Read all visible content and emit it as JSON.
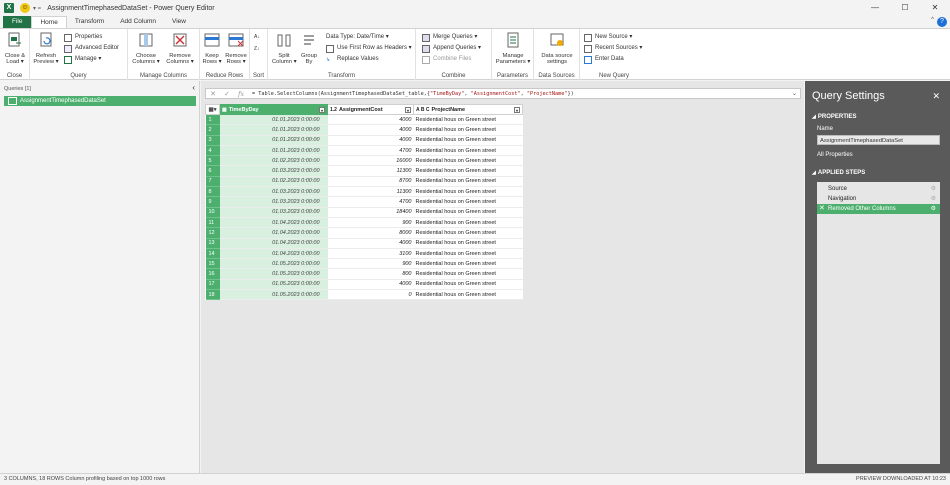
{
  "window": {
    "title": "AssignmentTimephasedDataSet - Power Query Editor",
    "minimize": "—",
    "maximize": "☐",
    "close": "✕"
  },
  "tabs": [
    {
      "label": "File"
    },
    {
      "label": "Home"
    },
    {
      "label": "Transform"
    },
    {
      "label": "Add Column"
    },
    {
      "label": "View"
    }
  ],
  "ribbon": {
    "close": {
      "btn": "Close &\nLoad ▾",
      "group": "Close"
    },
    "query": {
      "refresh": "Refresh\nPreview ▾",
      "properties": "Properties",
      "advanced_editor": "Advanced Editor",
      "manage": "Manage ▾",
      "group": "Query"
    },
    "manage_columns": {
      "choose": "Choose\nColumns ▾",
      "remove": "Remove\nColumns ▾",
      "group": "Manage Columns"
    },
    "reduce_rows": {
      "keep": "Keep\nRows ▾",
      "remove": "Remove\nRows ▾",
      "group": "Reduce Rows"
    },
    "sort": {
      "group": "Sort"
    },
    "transform": {
      "split": "Split\nColumn ▾",
      "group_by": "Group\nBy",
      "data_type": "Data Type: Date/Time ▾",
      "first_row": "Use First Row as Headers ▾",
      "replace": "Replace Values",
      "group": "Transform"
    },
    "combine": {
      "merge": "Merge Queries ▾",
      "append": "Append Queries ▾",
      "combine_files": "Combine Files",
      "group": "Combine"
    },
    "parameters": {
      "manage": "Manage\nParameters ▾",
      "group": "Parameters"
    },
    "data_sources": {
      "settings": "Data source\nsettings",
      "group": "Data Sources"
    },
    "new_query": {
      "new_source": "New Source ▾",
      "recent_sources": "Recent Sources ▾",
      "enter_data": "Enter Data",
      "group": "New Query"
    }
  },
  "queries_pane": {
    "header": "Queries [1]",
    "items": [
      {
        "label": "AssignmentTimephasedDataSet"
      }
    ]
  },
  "formula_bar": {
    "prefix": "= Table.SelectColumns(AssignmentTimephasedDataSet_table,{",
    "col1": "\"TimeByDay\"",
    "col2": "\"AssignmentCost\"",
    "col3": "\"ProjectName\"",
    "suffix": "})"
  },
  "grid": {
    "columns": [
      {
        "type_icon": "▦",
        "name": "TimeByDay"
      },
      {
        "type_icon": "1.2",
        "name": "AssignmentCost"
      },
      {
        "type_icon": "A B C",
        "name": "ProjectName"
      }
    ],
    "rows": [
      {
        "n": "1",
        "date": "01.01.2023 0:00:00",
        "cost": "4000",
        "project": "Residential hous on Green street"
      },
      {
        "n": "2",
        "date": "01.01.2023 0:00:00",
        "cost": "4000",
        "project": "Residential hous on Green street"
      },
      {
        "n": "3",
        "date": "01.01.2023 0:00:00",
        "cost": "4000",
        "project": "Residential hous on Green street"
      },
      {
        "n": "4",
        "date": "01.01.2023 0:00:00",
        "cost": "4700",
        "project": "Residential hous on Green street"
      },
      {
        "n": "5",
        "date": "01.02.2023 0:00:00",
        "cost": "16000",
        "project": "Residential hous on Green street"
      },
      {
        "n": "6",
        "date": "01.03.2023 0:00:00",
        "cost": "11300",
        "project": "Residential hous on Green street"
      },
      {
        "n": "7",
        "date": "01.02.2023 0:00:00",
        "cost": "8700",
        "project": "Residential hous on Green street"
      },
      {
        "n": "8",
        "date": "01.03.2023 0:00:00",
        "cost": "11300",
        "project": "Residential hous on Green street"
      },
      {
        "n": "9",
        "date": "01.03.2023 0:00:00",
        "cost": "4700",
        "project": "Residential hous on Green street"
      },
      {
        "n": "10",
        "date": "01.03.2023 0:00:00",
        "cost": "18400",
        "project": "Residential hous on Green street"
      },
      {
        "n": "11",
        "date": "01.04.2023 0:00:00",
        "cost": "900",
        "project": "Residential hous on Green street"
      },
      {
        "n": "12",
        "date": "01.04.2023 0:00:00",
        "cost": "8000",
        "project": "Residential hous on Green street"
      },
      {
        "n": "13",
        "date": "01.04.2023 0:00:00",
        "cost": "4000",
        "project": "Residential hous on Green street"
      },
      {
        "n": "14",
        "date": "01.04.2023 0:00:00",
        "cost": "3100",
        "project": "Residential hous on Green street"
      },
      {
        "n": "15",
        "date": "01.05.2023 0:00:00",
        "cost": "900",
        "project": "Residential hous on Green street"
      },
      {
        "n": "16",
        "date": "01.05.2023 0:00:00",
        "cost": "800",
        "project": "Residential hous on Green street"
      },
      {
        "n": "17",
        "date": "01.05.2023 0:00:00",
        "cost": "4000",
        "project": "Residential hous on Green street"
      },
      {
        "n": "18",
        "date": "01.05.2023 0:00:00",
        "cost": "0",
        "project": "Residential hous on Green street"
      }
    ]
  },
  "settings": {
    "title": "Query Settings",
    "properties_header": "PROPERTIES",
    "name_label": "Name",
    "name_value": "AssignmentTimephasedDataSet",
    "all_properties": "All Properties",
    "steps_header": "APPLIED STEPS",
    "steps": [
      {
        "label": "Source"
      },
      {
        "label": "Navigation"
      },
      {
        "label": "Removed Other Columns"
      }
    ]
  },
  "status": {
    "left": "3 COLUMNS, 18 ROWS    Column profiling based on top 1000 rows",
    "right": "PREVIEW DOWNLOADED AT 10:23"
  },
  "colors": {
    "accent": "#217346",
    "selection": "#4caf6e",
    "settings_bg": "#5a5a5a"
  }
}
